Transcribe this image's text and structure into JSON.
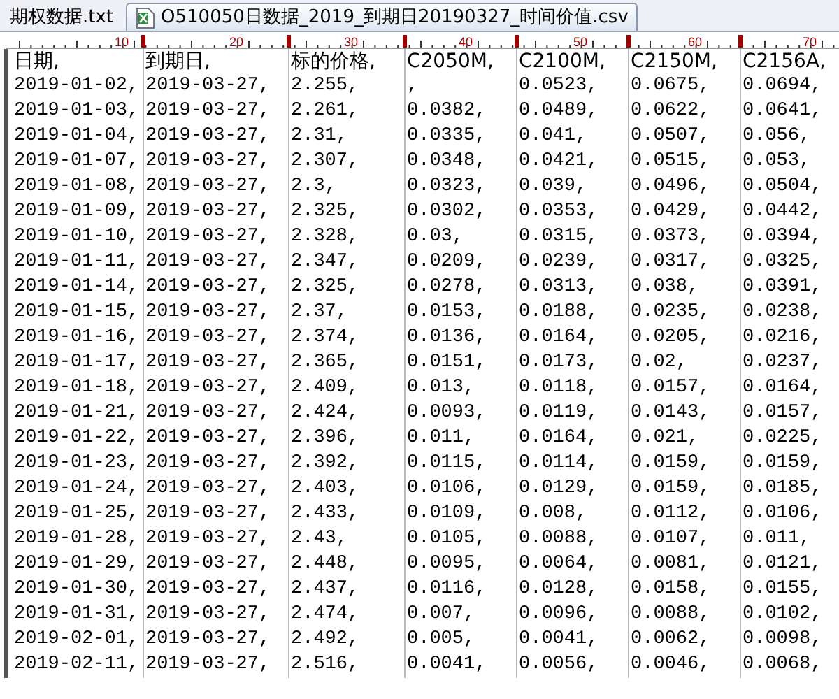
{
  "tabs": [
    {
      "label": "期权数据.txt",
      "selected": false,
      "kind": "txt"
    },
    {
      "label": "O510050日数据_2019_到期日20190327_时间价值.csv",
      "selected": true,
      "kind": "csv"
    }
  ],
  "ruler": {
    "labels": [
      "10",
      "20",
      "30",
      "40",
      "50",
      "60",
      "70"
    ]
  },
  "table": {
    "columns": [
      "日期,",
      "到期日,",
      "标的价格,",
      "C2050M,",
      "C2100M,",
      "C2150M,",
      "C2156A,"
    ],
    "rows": [
      [
        "2019-01-02,",
        "2019-03-27,",
        "2.255,",
        ",",
        "0.0523,",
        "0.0675,",
        "0.0694,"
      ],
      [
        "2019-01-03,",
        "2019-03-27,",
        "2.261,",
        "0.0382,",
        "0.0489,",
        "0.0622,",
        "0.0641,"
      ],
      [
        "2019-01-04,",
        "2019-03-27,",
        "2.31,",
        "0.0335,",
        "0.041,",
        "0.0507,",
        "0.056,"
      ],
      [
        "2019-01-07,",
        "2019-03-27,",
        "2.307,",
        "0.0348,",
        "0.0421,",
        "0.0515,",
        "0.053,"
      ],
      [
        "2019-01-08,",
        "2019-03-27,",
        "2.3,",
        "0.0323,",
        "0.039,",
        "0.0496,",
        "0.0504,"
      ],
      [
        "2019-01-09,",
        "2019-03-27,",
        "2.325,",
        "0.0302,",
        "0.0353,",
        "0.0429,",
        "0.0442,"
      ],
      [
        "2019-01-10,",
        "2019-03-27,",
        "2.328,",
        "0.03,",
        "0.0315,",
        "0.0373,",
        "0.0394,"
      ],
      [
        "2019-01-11,",
        "2019-03-27,",
        "2.347,",
        "0.0209,",
        "0.0239,",
        "0.0317,",
        "0.0325,"
      ],
      [
        "2019-01-14,",
        "2019-03-27,",
        "2.325,",
        "0.0278,",
        "0.0313,",
        "0.038,",
        "0.0391,"
      ],
      [
        "2019-01-15,",
        "2019-03-27,",
        "2.37,",
        "0.0153,",
        "0.0188,",
        "0.0235,",
        "0.0238,"
      ],
      [
        "2019-01-16,",
        "2019-03-27,",
        "2.374,",
        "0.0136,",
        "0.0164,",
        "0.0205,",
        "0.0216,"
      ],
      [
        "2019-01-17,",
        "2019-03-27,",
        "2.365,",
        "0.0151,",
        "0.0173,",
        "0.02,",
        "0.0237,"
      ],
      [
        "2019-01-18,",
        "2019-03-27,",
        "2.409,",
        "0.013,",
        "0.0118,",
        "0.0157,",
        "0.0164,"
      ],
      [
        "2019-01-21,",
        "2019-03-27,",
        "2.424,",
        "0.0093,",
        "0.0119,",
        "0.0143,",
        "0.0157,"
      ],
      [
        "2019-01-22,",
        "2019-03-27,",
        "2.396,",
        "0.011,",
        "0.0164,",
        "0.021,",
        "0.0225,"
      ],
      [
        "2019-01-23,",
        "2019-03-27,",
        "2.392,",
        "0.0115,",
        "0.0114,",
        "0.0159,",
        "0.0159,"
      ],
      [
        "2019-01-24,",
        "2019-03-27,",
        "2.403,",
        "0.0106,",
        "0.0129,",
        "0.0159,",
        "0.0185,"
      ],
      [
        "2019-01-25,",
        "2019-03-27,",
        "2.433,",
        "0.0109,",
        "0.008,",
        "0.0112,",
        "0.0106,"
      ],
      [
        "2019-01-28,",
        "2019-03-27,",
        "2.43,",
        "0.0105,",
        "0.0088,",
        "0.0107,",
        "0.011,"
      ],
      [
        "2019-01-29,",
        "2019-03-27,",
        "2.448,",
        "0.0095,",
        "0.0064,",
        "0.0081,",
        "0.0121,"
      ],
      [
        "2019-01-30,",
        "2019-03-27,",
        "2.437,",
        "0.0116,",
        "0.0128,",
        "0.0158,",
        "0.0155,"
      ],
      [
        "2019-01-31,",
        "2019-03-27,",
        "2.474,",
        "0.007,",
        "0.0096,",
        "0.0088,",
        "0.0102,"
      ],
      [
        "2019-02-01,",
        "2019-03-27,",
        "2.492,",
        "0.005,",
        "0.0041,",
        "0.0062,",
        "0.0098,"
      ],
      [
        "2019-02-11,",
        "2019-03-27,",
        "2.516,",
        "0.0041,",
        "0.0056,",
        "0.0046,",
        "0.0068,"
      ]
    ]
  }
}
